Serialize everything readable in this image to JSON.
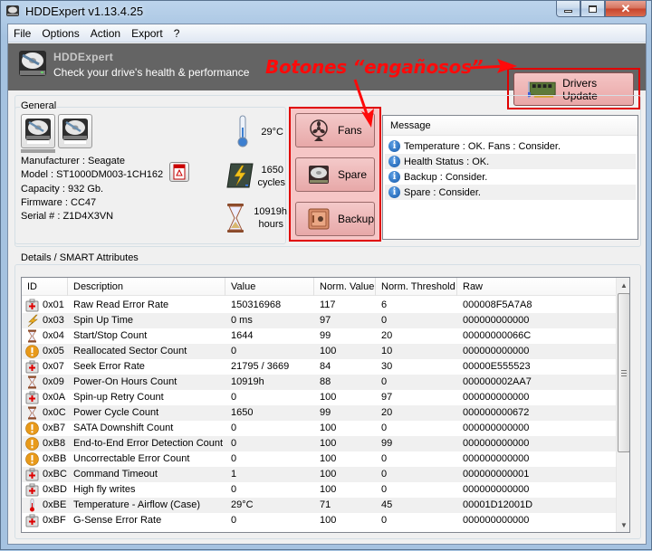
{
  "window": {
    "title": "HDDExpert v1.13.4.25",
    "buttons": {
      "minimize": "minimize",
      "maximize": "maximize",
      "close": "close"
    }
  },
  "menu": [
    "File",
    "Options",
    "Action",
    "Export",
    "?"
  ],
  "banner": {
    "title": "HDDExpert",
    "subtitle": "Check your drive's health & performance",
    "drivers_button": "Drivers Update"
  },
  "annotation": {
    "text": "Botones “engañosos”",
    "color": "#ff0a0a"
  },
  "general": {
    "label": "General",
    "drives": [
      "drive-1",
      "drive-2"
    ],
    "selected_drive": 0,
    "info": [
      "Manufacturer : Seagate",
      "Model : ST1000DM003-1CH162",
      "Capacity : 932 Gb.",
      "Firmware : CC47",
      "Serial # : Z1D4X3VN"
    ],
    "stats": {
      "temperature": "29°C",
      "cycles_value": "1650",
      "cycles_unit": "cycles",
      "hours_value": "10919h",
      "hours_unit": "hours"
    }
  },
  "side_buttons": [
    "Fans",
    "Spare",
    "Backup"
  ],
  "messages": {
    "header": "Message",
    "rows": [
      "Temperature : OK. Fans : Consider.",
      "Health Status : OK.",
      "Backup : Consider.",
      "Spare : Consider."
    ]
  },
  "smart": {
    "label": "Details / SMART Attributes",
    "columns": [
      "ID",
      "Description",
      "Value",
      "Norm. Value",
      "Norm. Threshold",
      "Raw"
    ],
    "rows": [
      {
        "icon": "medkit",
        "id": "0x01",
        "desc": "Raw Read Error Rate",
        "value": "150316968",
        "norm": "117",
        "thresh": "6",
        "raw": "000008F5A7A8"
      },
      {
        "icon": "bolt",
        "id": "0x03",
        "desc": "Spin Up Time",
        "value": "0 ms",
        "norm": "97",
        "thresh": "0",
        "raw": "000000000000"
      },
      {
        "icon": "hourglass",
        "id": "0x04",
        "desc": "Start/Stop Count",
        "value": "1644",
        "norm": "99",
        "thresh": "20",
        "raw": "00000000066C"
      },
      {
        "icon": "warning",
        "id": "0x05",
        "desc": "Reallocated Sector Count",
        "value": "0",
        "norm": "100",
        "thresh": "10",
        "raw": "000000000000"
      },
      {
        "icon": "medkit",
        "id": "0x07",
        "desc": "Seek Error Rate",
        "value": "21795 / 3669",
        "norm": "84",
        "thresh": "30",
        "raw": "00000E555523"
      },
      {
        "icon": "hourglass",
        "id": "0x09",
        "desc": "Power-On Hours Count",
        "value": "10919h",
        "norm": "88",
        "thresh": "0",
        "raw": "000000002AA7"
      },
      {
        "icon": "medkit",
        "id": "0x0A",
        "desc": "Spin-up Retry Count",
        "value": "0",
        "norm": "100",
        "thresh": "97",
        "raw": "000000000000"
      },
      {
        "icon": "hourglass",
        "id": "0x0C",
        "desc": "Power Cycle Count",
        "value": "1650",
        "norm": "99",
        "thresh": "20",
        "raw": "000000000672"
      },
      {
        "icon": "warning",
        "id": "0xB7",
        "desc": "SATA Downshift Count",
        "value": "0",
        "norm": "100",
        "thresh": "0",
        "raw": "000000000000"
      },
      {
        "icon": "warning",
        "id": "0xB8",
        "desc": "End-to-End Error Detection Count",
        "value": "0",
        "norm": "100",
        "thresh": "99",
        "raw": "000000000000"
      },
      {
        "icon": "warning",
        "id": "0xBB",
        "desc": "Uncorrectable Error Count",
        "value": "0",
        "norm": "100",
        "thresh": "0",
        "raw": "000000000000"
      },
      {
        "icon": "medkit",
        "id": "0xBC",
        "desc": "Command Timeout",
        "value": "1",
        "norm": "100",
        "thresh": "0",
        "raw": "000000000001"
      },
      {
        "icon": "medkit",
        "id": "0xBD",
        "desc": "High fly writes",
        "value": "0",
        "norm": "100",
        "thresh": "0",
        "raw": "000000000000"
      },
      {
        "icon": "thermometer",
        "id": "0xBE",
        "desc": "Temperature - Airflow (Case)",
        "value": "29°C",
        "norm": "71",
        "thresh": "45",
        "raw": "00001D12001D"
      },
      {
        "icon": "medkit",
        "id": "0xBF",
        "desc": "G-Sense Error Rate",
        "value": "0",
        "norm": "100",
        "thresh": "0",
        "raw": "000000000000"
      }
    ]
  }
}
